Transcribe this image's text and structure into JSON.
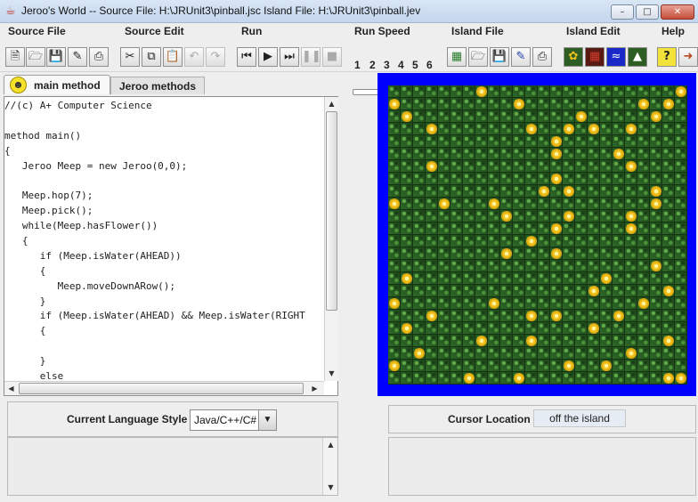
{
  "window": {
    "title": "Jeroo's World -- Source File: H:\\JRUnit3\\pinball.jsc      Island File: H:\\JRUnit3\\pinball.jev",
    "minimize_glyph": "–",
    "maximize_glyph": "□",
    "close_glyph": "✕"
  },
  "menus": [
    "Source File",
    "Source Edit",
    "Run",
    "Run Speed",
    "Island File",
    "Island Edit",
    "Help"
  ],
  "toolbar": {
    "icons": [
      "new-file-icon",
      "open-folder-icon",
      "save-icon",
      "save-as-icon",
      "print-icon",
      "cut-icon",
      "copy-icon",
      "paste-icon",
      "undo-icon",
      "redo-icon",
      "reset-icon",
      "run-icon",
      "step-icon",
      "pause-icon",
      "stop-icon",
      "new-island-icon",
      "open-island-icon",
      "save-island-icon",
      "save-island-as-icon",
      "print-island-icon",
      "flower-tool-icon",
      "net-tool-icon",
      "water-tool-icon",
      "land-tool-icon",
      "help-icon",
      "exit-icon"
    ],
    "speed": {
      "labels": [
        "1",
        "2",
        "3",
        "4",
        "5",
        "6"
      ],
      "value": 6
    }
  },
  "tabs": {
    "main": "main method",
    "jeroo": "Jeroo methods"
  },
  "code": [
    "//(c) A+ Computer Science",
    "",
    "method main()",
    "{",
    "   Jeroo Meep = new Jeroo(0,0);",
    "",
    "   Meep.hop(7);",
    "   Meep.pick();",
    "   while(Meep.hasFlower())",
    "   {",
    "      if (Meep.isWater(AHEAD))",
    "      {",
    "         Meep.moveDownARow();",
    "      }",
    "      if (Meep.isWater(AHEAD) && Meep.isWater(RIGHT",
    "      {",
    "",
    "      }",
    "      else"
  ],
  "language": {
    "label": "Current Language Style",
    "value": "Java/C++/C#"
  },
  "cursor": {
    "label": "Cursor Location",
    "value": "off the island"
  },
  "island": {
    "size": 24,
    "flowers": [
      [
        0,
        7
      ],
      [
        0,
        23
      ],
      [
        1,
        0
      ],
      [
        1,
        10
      ],
      [
        1,
        20
      ],
      [
        1,
        22
      ],
      [
        2,
        1
      ],
      [
        2,
        15
      ],
      [
        2,
        21
      ],
      [
        3,
        3
      ],
      [
        3,
        11
      ],
      [
        3,
        14
      ],
      [
        3,
        16
      ],
      [
        3,
        19
      ],
      [
        4,
        13
      ],
      [
        5,
        13
      ],
      [
        5,
        18
      ],
      [
        6,
        3
      ],
      [
        6,
        19
      ],
      [
        7,
        13
      ],
      [
        8,
        12
      ],
      [
        8,
        14
      ],
      [
        8,
        21
      ],
      [
        9,
        0
      ],
      [
        9,
        4
      ],
      [
        9,
        8
      ],
      [
        9,
        21
      ],
      [
        10,
        9
      ],
      [
        10,
        14
      ],
      [
        10,
        19
      ],
      [
        11,
        13
      ],
      [
        11,
        19
      ],
      [
        12,
        11
      ],
      [
        13,
        9
      ],
      [
        13,
        13
      ],
      [
        14,
        21
      ],
      [
        15,
        1
      ],
      [
        15,
        17
      ],
      [
        16,
        16
      ],
      [
        16,
        22
      ],
      [
        17,
        0
      ],
      [
        17,
        8
      ],
      [
        17,
        20
      ],
      [
        18,
        3
      ],
      [
        18,
        11
      ],
      [
        18,
        13
      ],
      [
        18,
        18
      ],
      [
        19,
        1
      ],
      [
        19,
        16
      ],
      [
        20,
        7
      ],
      [
        20,
        11
      ],
      [
        20,
        22
      ],
      [
        21,
        2
      ],
      [
        21,
        19
      ],
      [
        22,
        0
      ],
      [
        22,
        14
      ],
      [
        22,
        17
      ],
      [
        23,
        6
      ],
      [
        23,
        10
      ],
      [
        23,
        22
      ],
      [
        23,
        23
      ]
    ]
  }
}
